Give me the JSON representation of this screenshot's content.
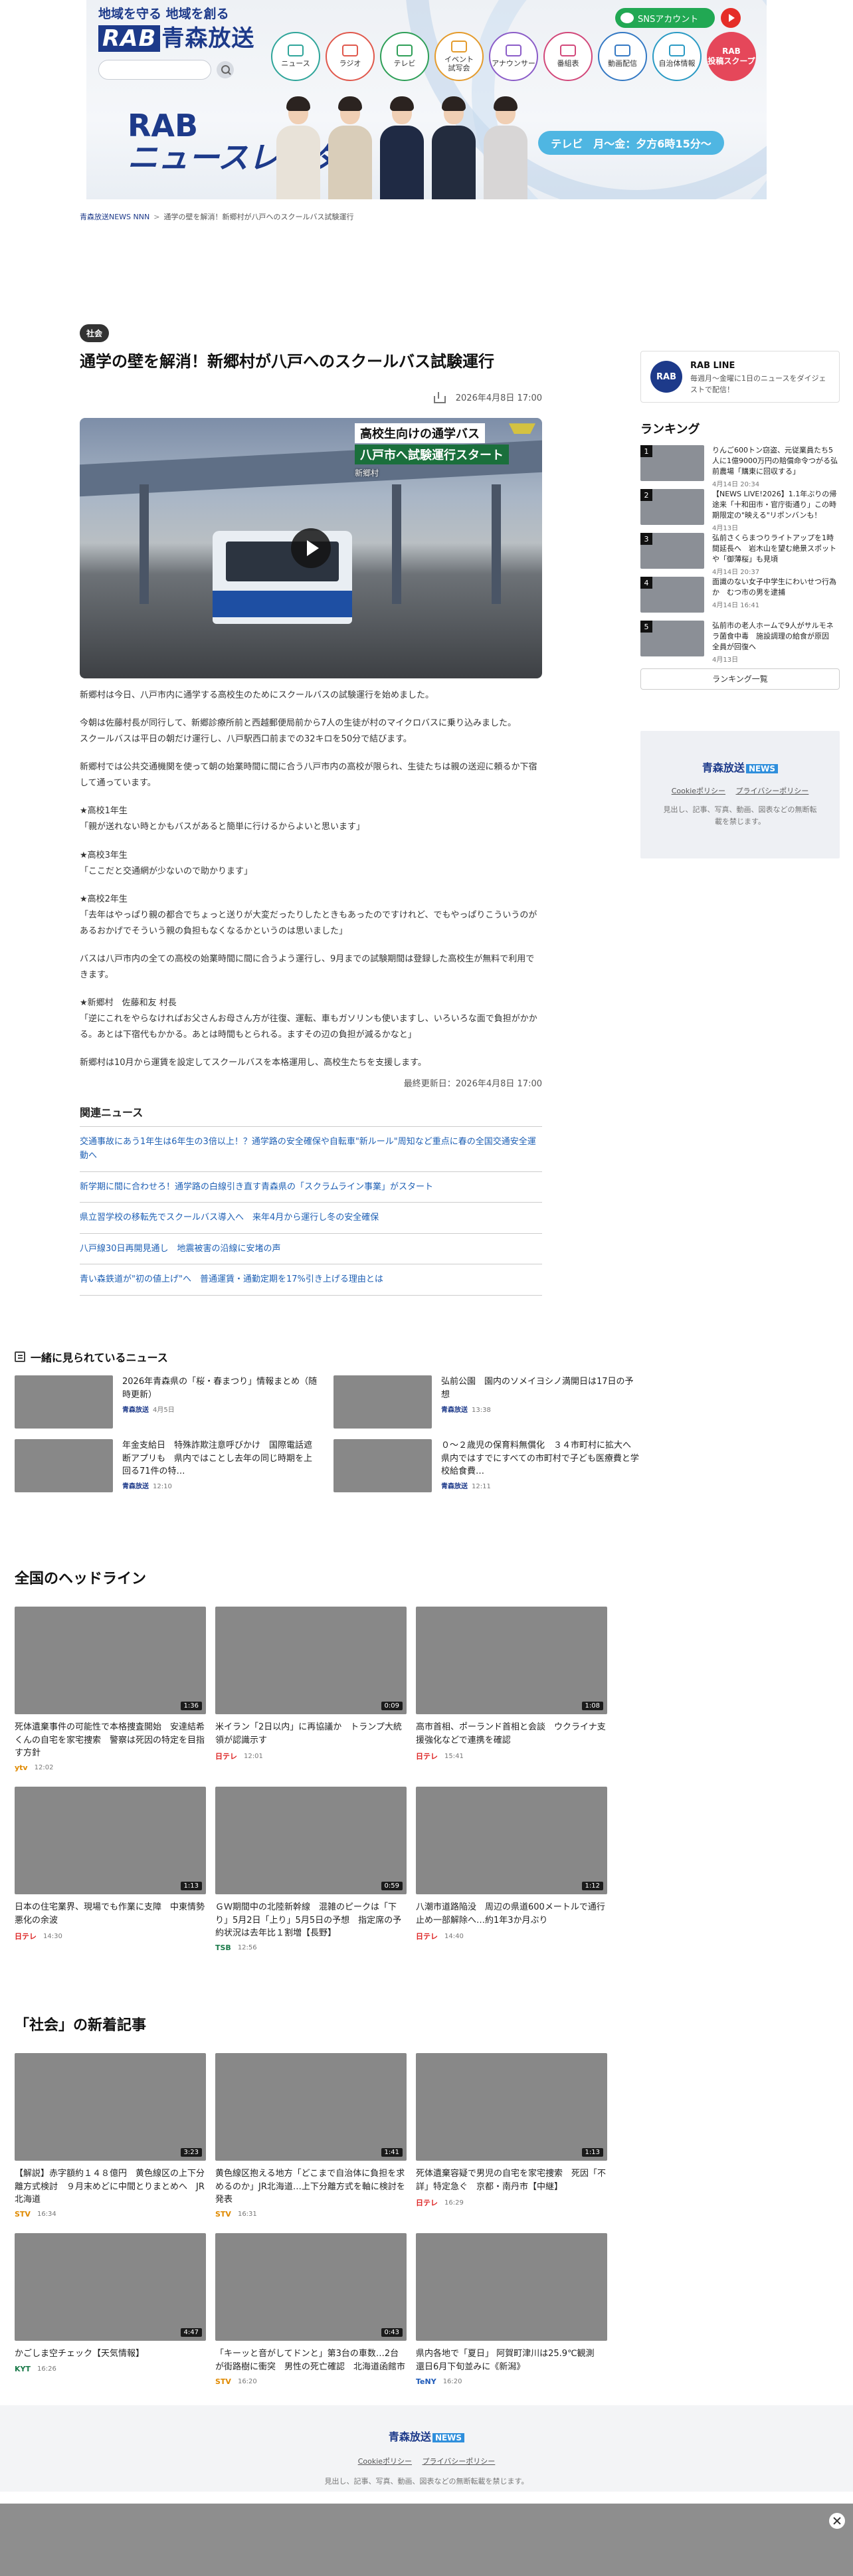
{
  "header": {
    "slogan": "地域を守る 地域を創る",
    "logo_abbr": "RAB",
    "logo_name": "青森放送",
    "search_placeholder": "",
    "sns_label": "SNSアカウント",
    "nav": [
      {
        "label": "ニュース"
      },
      {
        "label": "ラジオ"
      },
      {
        "label": "テレビ"
      },
      {
        "label": "イベント\n試写会"
      },
      {
        "label": "アナウンサー"
      },
      {
        "label": "番組表"
      },
      {
        "label": "動画配信"
      },
      {
        "label": "自治体情報"
      }
    ],
    "scoop_label": "RAB\n投稿スクープ",
    "banner_line1": "RAB",
    "banner_line2": "ニュースレーダー",
    "banner_schedule": "テレビ　月〜金：夕方6時15分〜"
  },
  "breadcrumb": {
    "home": "青森放送NEWS NNN",
    "current": "通学の壁を解消！新郷村が八戸へのスクールバス試験運行"
  },
  "article": {
    "category": "社会",
    "title": "通学の壁を解消！新郷村が八戸へのスクールバス試験運行",
    "date": "2026年4月8日 17:00",
    "video_caption_1": "高校生向けの通学バス",
    "video_caption_2": "八戸市へ試験運行スタート",
    "video_location": "新郷村",
    "paragraphs": [
      "新郷村は今日、八戸市内に通学する高校生のためにスクールバスの試験運行を始めました。",
      "今朝は佐藤村長が同行して、新郷診療所前と西越郵便局前から7人の生徒が村のマイクロバスに乗り込みました。\nスクールバスは平日の朝だけ運行し、八戸駅西口前までの32キロを50分で結びます。",
      "新郷村では公共交通機関を使って朝の始業時間に間に合う八戸市内の高校が限られ、生徒たちは親の送迎に頼るか下宿して通っています。",
      "★高校1年生\n「親が送れない時とかもバスがあると簡単に行けるからよいと思います」",
      "★高校3年生\n「ここだと交通網が少ないので助かります」",
      "★高校2年生\n「去年はやっぱり親の都合でちょっと送りが大変だったりしたときもあったのですけれど、でもやっぱりこういうのがあるおかげでそういう親の負担もなくなるかというのは思いました」",
      "バスは八戸市内の全ての高校の始業時間に間に合うよう運行し、9月までの試験期間は登録した高校生が無料で利用できます。",
      "★新郷村　佐藤和友 村長\n「逆にこれをやらなければお父さんお母さん方が往復、運転、車もガソリンも使いますし、いろいろな面で負担がかかる。あとは下宿代もかかる。あとは時間もとられる。ますその辺の負担が減るかなと」",
      "新郷村は10月から運賃を設定してスクールバスを本格運用し、高校生たちを支援します。"
    ],
    "updated": "最終更新日：2026年4月8日 17:00"
  },
  "related": {
    "heading": "関連ニュース",
    "items": [
      "交通事故にあう1年生は6年生の3倍以上！？通学路の安全確保や自転車\"新ルール\"周知など重点に春の全国交通安全運動へ",
      "新学期に間に合わせろ！通学路の白線引き直す青森県の「スクラムライン事業」がスタート",
      "県立習学校の移転先でスクールバス導入へ　来年4月から運行し冬の安全確保",
      "八戸線30日再開見通し　地震被害の沿線に安堵の声",
      "青い森鉄道が\"初の値上げ\"へ　普通運賃・通勤定期を17%引き上げる理由とは"
    ]
  },
  "sidebar": {
    "line_title": "RAB LINE",
    "line_desc": "毎週月〜金曜に1日のニュースをダイジェストで配信！",
    "line_icon_text": "RAB",
    "ranking_heading": "ランキング",
    "ranking": [
      {
        "num": "1",
        "title": "りんご600トン窃盗、元従業員たち5人に1億9000万円の賠償命令つがる弘前農場「購東に回収する」",
        "date": "4月14日 20:34"
      },
      {
        "num": "2",
        "title": "【NEWS LIVE!2026】1.1年ぶりの帰途来「十和田市・官庁街通り」この時期限定の\"映える\"リポンバンも！",
        "date": "4月13日"
      },
      {
        "num": "3",
        "title": "弘前さくらまつりライトアップを1時間延長へ　岩木山を望む絶景スポットや「御薄桜」も見頃",
        "date": "4月14日 20:37"
      },
      {
        "num": "4",
        "title": "面識のない女子中学生にわいせつ行為か　むつ市の男を逮捕",
        "date": "4月14日 16:41"
      },
      {
        "num": "5",
        "title": "弘前市の老人ホームで9人がサルモネラ菌食中毒　施設調理の給食が原因　全員が回復へ",
        "date": "4月13日"
      }
    ],
    "ranking_more": "ランキング一覧",
    "brand": "青森放送",
    "brand_tag": "NEWS",
    "cookie_link": "Cookieポリシー",
    "privacy_link": "プライバシーポリシー",
    "brand_desc": "見出し、記事、写真、動画、図表などの無断転載を禁じます。"
  },
  "also_viewed": {
    "heading": "一緒に見られているニュース",
    "items": [
      {
        "title": "2026年青森県の「桜・春まつり」情報まとめ（随時更新）",
        "source": "青森放送",
        "date": "4月5日"
      },
      {
        "title": "弘前公園　園内のソメイヨシノ満開日は17日の予想",
        "source": "青森放送",
        "date": "13:38"
      },
      {
        "title": "年金支給日　特殊詐欺注意呼びかけ　国際電話遮断アプリも　県内ではことし去年の同じ時期を上回る71件の特…",
        "source": "青森放送",
        "date": "12:10"
      },
      {
        "title": "０～２歳児の保育料無償化　３４市町村に拡大へ　県内ではすでにすべての市町村で子ども医療費と学校給食費…",
        "source": "青森放送",
        "date": "12:11"
      }
    ]
  },
  "national": {
    "heading": "全国のヘッドライン",
    "items": [
      {
        "title": "死体遺棄事件の可能性で本格捜査開始　安達結希くんの自宅を家宅捜索　警察は死因の特定を目指す方針",
        "net": "ytv",
        "time": "12:02",
        "dur": "1:36"
      },
      {
        "title": "米イラン「2日以内」に再協議か　トランプ大統領が認識示す",
        "net": "日テレ",
        "time": "12:01",
        "dur": "0:09"
      },
      {
        "title": "高市首相、ポーランド首相と会談　ウクライナ支援強化などで連携を確認",
        "net": "日テレ",
        "time": "15:41",
        "dur": "1:08"
      },
      {
        "title": "日本の住宅業界、現場でも作業に支障　中東情勢悪化の余波",
        "net": "日テレ",
        "time": "14:30",
        "dur": "1:13"
      },
      {
        "title": "ＧＷ期間中の北陸新幹線　混雑のピークは「下り」5月2日「上り」5月5日の予想　指定席の予約状況は去年比１割増【長野】",
        "net": "TSB",
        "time": "12:56",
        "dur": "0:59"
      },
      {
        "title": "八潮市道路陥没　周辺の県道600メートルで通行止め一部解除へ…約1年3か月ぶり",
        "net": "日テレ",
        "time": "14:40",
        "dur": "1:12"
      }
    ]
  },
  "social": {
    "heading": "「社会」の新着記事",
    "items": [
      {
        "title": "【解説】赤字額約１４８億円　黄色線区の上下分離方式検討　９月末めどに中間とりまとめへ　JR北海道",
        "net": "STV",
        "time": "16:34",
        "dur": "3:23"
      },
      {
        "title": "黄色線区抱える地方「どこまで自治体に負担を求めるのか」JR北海道…上下分離方式を軸に検討を発表",
        "net": "STV",
        "time": "16:31",
        "dur": "1:41"
      },
      {
        "title": "死体遺棄容疑で男児の自宅を家宅捜索　死因「不詳」特定急ぐ　京都・南丹市【中継】",
        "net": "日テレ",
        "time": "16:29",
        "dur": "1:13"
      },
      {
        "title": "かごしま空チェック【天気情報】",
        "net": "KYT",
        "time": "16:26",
        "dur": "4:47"
      },
      {
        "title": "「キーッと音がしてドンと」第3台の車数…2台が街路樹に衝突　男性の死亡確認　北海道函館市",
        "net": "STV",
        "time": "16:20",
        "dur": "0:43"
      },
      {
        "title": "県内各地で「夏日」 阿賀町津川は25.9℃観測　還日6月下旬並みに《新潟》",
        "net": "TeNY",
        "time": "16:20",
        "dur": ""
      }
    ]
  },
  "footer": {
    "brand": "青森放送",
    "brand_tag": "NEWS",
    "cookie_link": "Cookieポリシー",
    "privacy_link": "プライバシーポリシー",
    "desc": "見出し、記事、写真、動画、図表などの無断転載を禁じます。"
  }
}
